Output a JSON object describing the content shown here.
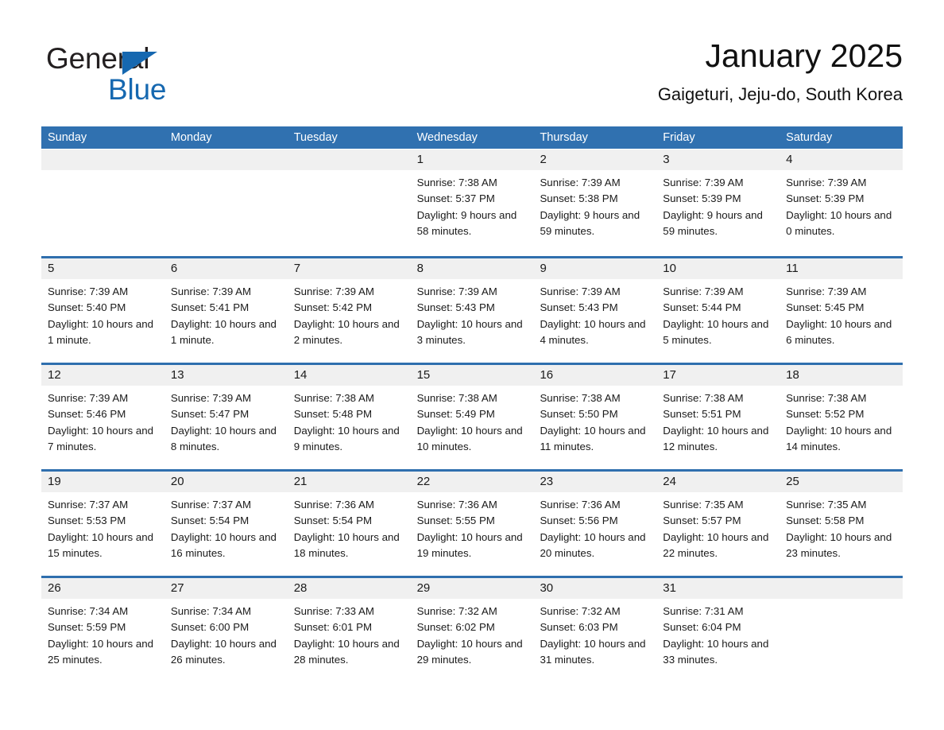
{
  "brand": {
    "name_part1": "General",
    "name_part2": "Blue",
    "triangle_icon": "triangle-logo-icon",
    "accent_color": "#1668b0"
  },
  "header": {
    "title": "January 2025",
    "subtitle": "Gaigeturi, Jeju-do, South Korea"
  },
  "calendar": {
    "header_bg": "#3071b0",
    "row_border": "#2f6fae",
    "daynum_bg": "#f0f0f0",
    "weekdays": [
      "Sunday",
      "Monday",
      "Tuesday",
      "Wednesday",
      "Thursday",
      "Friday",
      "Saturday"
    ],
    "weeks": [
      [
        {
          "day": "",
          "sunrise": "",
          "sunset": "",
          "daylight": "",
          "empty": true
        },
        {
          "day": "",
          "sunrise": "",
          "sunset": "",
          "daylight": "",
          "empty": true
        },
        {
          "day": "",
          "sunrise": "",
          "sunset": "",
          "daylight": "",
          "empty": true
        },
        {
          "day": "1",
          "sunrise": "Sunrise: 7:38 AM",
          "sunset": "Sunset: 5:37 PM",
          "daylight": "Daylight: 9 hours and 58 minutes."
        },
        {
          "day": "2",
          "sunrise": "Sunrise: 7:39 AM",
          "sunset": "Sunset: 5:38 PM",
          "daylight": "Daylight: 9 hours and 59 minutes."
        },
        {
          "day": "3",
          "sunrise": "Sunrise: 7:39 AM",
          "sunset": "Sunset: 5:39 PM",
          "daylight": "Daylight: 9 hours and 59 minutes."
        },
        {
          "day": "4",
          "sunrise": "Sunrise: 7:39 AM",
          "sunset": "Sunset: 5:39 PM",
          "daylight": "Daylight: 10 hours and 0 minutes."
        }
      ],
      [
        {
          "day": "5",
          "sunrise": "Sunrise: 7:39 AM",
          "sunset": "Sunset: 5:40 PM",
          "daylight": "Daylight: 10 hours and 1 minute."
        },
        {
          "day": "6",
          "sunrise": "Sunrise: 7:39 AM",
          "sunset": "Sunset: 5:41 PM",
          "daylight": "Daylight: 10 hours and 1 minute."
        },
        {
          "day": "7",
          "sunrise": "Sunrise: 7:39 AM",
          "sunset": "Sunset: 5:42 PM",
          "daylight": "Daylight: 10 hours and 2 minutes."
        },
        {
          "day": "8",
          "sunrise": "Sunrise: 7:39 AM",
          "sunset": "Sunset: 5:43 PM",
          "daylight": "Daylight: 10 hours and 3 minutes."
        },
        {
          "day": "9",
          "sunrise": "Sunrise: 7:39 AM",
          "sunset": "Sunset: 5:43 PM",
          "daylight": "Daylight: 10 hours and 4 minutes."
        },
        {
          "day": "10",
          "sunrise": "Sunrise: 7:39 AM",
          "sunset": "Sunset: 5:44 PM",
          "daylight": "Daylight: 10 hours and 5 minutes."
        },
        {
          "day": "11",
          "sunrise": "Sunrise: 7:39 AM",
          "sunset": "Sunset: 5:45 PM",
          "daylight": "Daylight: 10 hours and 6 minutes."
        }
      ],
      [
        {
          "day": "12",
          "sunrise": "Sunrise: 7:39 AM",
          "sunset": "Sunset: 5:46 PM",
          "daylight": "Daylight: 10 hours and 7 minutes."
        },
        {
          "day": "13",
          "sunrise": "Sunrise: 7:39 AM",
          "sunset": "Sunset: 5:47 PM",
          "daylight": "Daylight: 10 hours and 8 minutes."
        },
        {
          "day": "14",
          "sunrise": "Sunrise: 7:38 AM",
          "sunset": "Sunset: 5:48 PM",
          "daylight": "Daylight: 10 hours and 9 minutes."
        },
        {
          "day": "15",
          "sunrise": "Sunrise: 7:38 AM",
          "sunset": "Sunset: 5:49 PM",
          "daylight": "Daylight: 10 hours and 10 minutes."
        },
        {
          "day": "16",
          "sunrise": "Sunrise: 7:38 AM",
          "sunset": "Sunset: 5:50 PM",
          "daylight": "Daylight: 10 hours and 11 minutes."
        },
        {
          "day": "17",
          "sunrise": "Sunrise: 7:38 AM",
          "sunset": "Sunset: 5:51 PM",
          "daylight": "Daylight: 10 hours and 12 minutes."
        },
        {
          "day": "18",
          "sunrise": "Sunrise: 7:38 AM",
          "sunset": "Sunset: 5:52 PM",
          "daylight": "Daylight: 10 hours and 14 minutes."
        }
      ],
      [
        {
          "day": "19",
          "sunrise": "Sunrise: 7:37 AM",
          "sunset": "Sunset: 5:53 PM",
          "daylight": "Daylight: 10 hours and 15 minutes."
        },
        {
          "day": "20",
          "sunrise": "Sunrise: 7:37 AM",
          "sunset": "Sunset: 5:54 PM",
          "daylight": "Daylight: 10 hours and 16 minutes."
        },
        {
          "day": "21",
          "sunrise": "Sunrise: 7:36 AM",
          "sunset": "Sunset: 5:54 PM",
          "daylight": "Daylight: 10 hours and 18 minutes."
        },
        {
          "day": "22",
          "sunrise": "Sunrise: 7:36 AM",
          "sunset": "Sunset: 5:55 PM",
          "daylight": "Daylight: 10 hours and 19 minutes."
        },
        {
          "day": "23",
          "sunrise": "Sunrise: 7:36 AM",
          "sunset": "Sunset: 5:56 PM",
          "daylight": "Daylight: 10 hours and 20 minutes."
        },
        {
          "day": "24",
          "sunrise": "Sunrise: 7:35 AM",
          "sunset": "Sunset: 5:57 PM",
          "daylight": "Daylight: 10 hours and 22 minutes."
        },
        {
          "day": "25",
          "sunrise": "Sunrise: 7:35 AM",
          "sunset": "Sunset: 5:58 PM",
          "daylight": "Daylight: 10 hours and 23 minutes."
        }
      ],
      [
        {
          "day": "26",
          "sunrise": "Sunrise: 7:34 AM",
          "sunset": "Sunset: 5:59 PM",
          "daylight": "Daylight: 10 hours and 25 minutes."
        },
        {
          "day": "27",
          "sunrise": "Sunrise: 7:34 AM",
          "sunset": "Sunset: 6:00 PM",
          "daylight": "Daylight: 10 hours and 26 minutes."
        },
        {
          "day": "28",
          "sunrise": "Sunrise: 7:33 AM",
          "sunset": "Sunset: 6:01 PM",
          "daylight": "Daylight: 10 hours and 28 minutes."
        },
        {
          "day": "29",
          "sunrise": "Sunrise: 7:32 AM",
          "sunset": "Sunset: 6:02 PM",
          "daylight": "Daylight: 10 hours and 29 minutes."
        },
        {
          "day": "30",
          "sunrise": "Sunrise: 7:32 AM",
          "sunset": "Sunset: 6:03 PM",
          "daylight": "Daylight: 10 hours and 31 minutes."
        },
        {
          "day": "31",
          "sunrise": "Sunrise: 7:31 AM",
          "sunset": "Sunset: 6:04 PM",
          "daylight": "Daylight: 10 hours and 33 minutes."
        },
        {
          "day": "",
          "sunrise": "",
          "sunset": "",
          "daylight": "",
          "empty": true
        }
      ]
    ]
  }
}
